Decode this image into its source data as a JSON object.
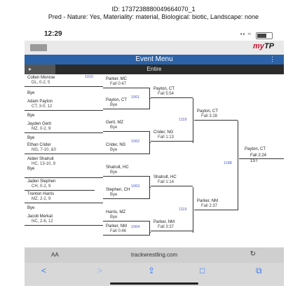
{
  "caption": {
    "line1": "ID: 1737238880049664070_1",
    "line2": "Pred - Nature: Yes, Materiality: material, Biological: biotic, Landscape: none"
  },
  "status": {
    "time": "12:29",
    "signal": "▪▪ ≈"
  },
  "app": {
    "logo_my": "my",
    "logo_mark": "TP"
  },
  "event": {
    "title": "Event Menu",
    "more": "⋮"
  },
  "filter": {
    "back": "▸",
    "title": "Entire"
  },
  "bracket": {
    "r1": [
      {
        "name": "Colten Monroe",
        "result": "DL, 0-2, 5"
      },
      {
        "name": "Bye",
        "result": ""
      },
      {
        "name": "Adam Payton",
        "result": "CT, 3-0, 12"
      },
      {
        "name": "Bye",
        "result": ""
      },
      {
        "name": "Jayden Gerit",
        "result": "MZ, 0-2, 9"
      },
      {
        "name": "Bye",
        "result": ""
      },
      {
        "name": "Ethan Crider",
        "result": "NG, 7-10, &0"
      },
      {
        "name": "Aiden Shatruit",
        "result": "HC, 13-10, 9"
      },
      {
        "name": "Bye",
        "result": ""
      },
      {
        "name": "Jaden Stephen",
        "result": "CH, 0-2, 9"
      },
      {
        "name": "Trenton Harris",
        "result": "MZ, 2-2, 9"
      },
      {
        "name": "Bye",
        "result": ""
      },
      {
        "name": "Jacob Merkat",
        "result": "NC, 2-6, 12"
      }
    ],
    "r2": [
      {
        "name": "Parker, MC",
        "result": "Fall 0:47",
        "bout": "1010"
      },
      {
        "name": "Payton, CT",
        "result": "Bye",
        "bout": ""
      },
      {
        "name": "Gerit, MZ",
        "result": "Bye",
        "bout": ""
      },
      {
        "name": "Crider, NG",
        "result": "Bye",
        "bout": ""
      },
      {
        "name": "Shatrult, HC",
        "result": "Bye",
        "bout": ""
      },
      {
        "name": "Stephen, CH",
        "result": "Bye",
        "bout": ""
      },
      {
        "name": "Harris, MZ",
        "result": "Bye",
        "bout": ""
      },
      {
        "name": "Parker, NM",
        "result": "Fall 0:46",
        "bout": ""
      }
    ],
    "r2_bouts": [
      "1061",
      "1062",
      "1063",
      "1064"
    ],
    "r3": [
      {
        "name": "Payton, CT",
        "result": "Fall 5:54"
      },
      {
        "name": "Crider, NG",
        "result": "Fall 1:13"
      },
      {
        "name": "Shatrult, HC",
        "result": "Fall 1:14"
      },
      {
        "name": "Parker, NM",
        "result": "Fall 3:37"
      }
    ],
    "r3_bouts": [
      "1118",
      "1119"
    ],
    "r4": [
      {
        "name": "Payton, CT",
        "result": "Fall 3:28"
      },
      {
        "name": "Parker, NM",
        "result": "Fall 2:37"
      }
    ],
    "r4_bout": "1188",
    "champion": {
      "name": "Payton, CT",
      "result": "Fall 2:24",
      "place": "1ST"
    }
  },
  "browser": {
    "aa": "AA",
    "url": "trackwrestling.com",
    "reload": "↻",
    "back": "<",
    "forward": ">",
    "share": "⇪",
    "bookmarks": "□",
    "tabs": "⧉"
  }
}
